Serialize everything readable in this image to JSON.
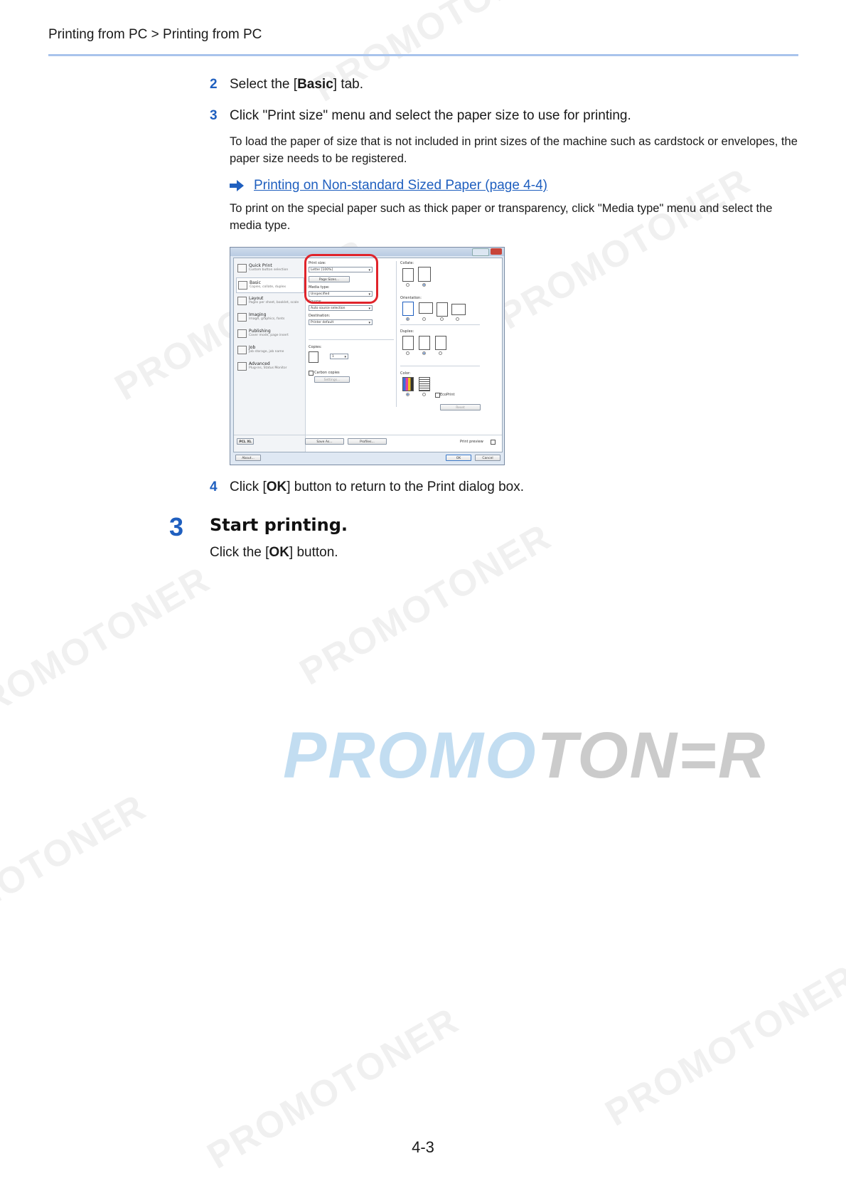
{
  "header": {
    "breadcrumb": "Printing from PC > Printing from PC"
  },
  "steps": [
    {
      "num": "2",
      "pre": "Select the [",
      "bold": "Basic",
      "post": "] tab."
    },
    {
      "num": "3",
      "text": "Click \"Print size\" menu and select the paper size to use for printing."
    },
    {
      "num": "4",
      "pre": "Click [",
      "bold": "OK",
      "post": "] button to return to the Print dialog box."
    }
  ],
  "notes": {
    "note1": "To load the paper of size that is not included in print sizes of the machine such as cardstock or envelopes, the paper size needs to be registered.",
    "link": "Printing on Non-standard Sized Paper (page 4-4)",
    "note2": "To print on the special paper such as thick paper or transparency, click \"Media type\" menu and select the media type."
  },
  "section": {
    "num": "3",
    "title": "Start printing.",
    "pre": "Click the [",
    "bold": "OK",
    "post": "] button."
  },
  "dialog": {
    "sidebar": [
      {
        "title": "Quick Print",
        "sub": "Custom button selection"
      },
      {
        "title": "Basic",
        "sub": "Copies, collate, duplex"
      },
      {
        "title": "Layout",
        "sub": "Pages per sheet, booklet, scale"
      },
      {
        "title": "Imaging",
        "sub": "Image, graphics, fonts"
      },
      {
        "title": "Publishing",
        "sub": "Cover mode, page insert"
      },
      {
        "title": "Job",
        "sub": "Job storage, job name"
      },
      {
        "title": "Advanced",
        "sub": "Plug-ins, Status Monitor"
      }
    ],
    "print_size_label": "Print size:",
    "print_size_value": "Letter [100%]",
    "page_sizes_button": "Page Sizes...",
    "media_type_label": "Media type:",
    "media_type_value": "Unspecified",
    "source_label": "Source:",
    "source_value": "Auto source selection",
    "destination_label": "Destination:",
    "destination_value": "Printer default",
    "copies_label": "Copies:",
    "copies_value": "1",
    "carbon_copies": "Carbon copies",
    "settings_button": "Settings...",
    "collate_label": "Collate:",
    "orientation_label": "Orientation:",
    "duplex_label": "Duplex:",
    "color_label": "Color:",
    "ecoprint": "EcoPrint",
    "reset_button": "Reset",
    "pcl_label": "PCL XL",
    "save_as_button": "Save As...",
    "profiles_button": "Profiles...",
    "print_preview": "Print preview",
    "about_button": "About...",
    "ok_button": "OK",
    "cancel_button": "Cancel"
  },
  "watermark": {
    "text": "PROMOTONER",
    "logo_part1": "PROMO",
    "logo_part2": "TON=R"
  },
  "footer": {
    "page_number": "4-3"
  },
  "colors": {
    "accent": "#1f5fbf",
    "rule": "#a9c4ec",
    "highlight": "#e0242b"
  }
}
